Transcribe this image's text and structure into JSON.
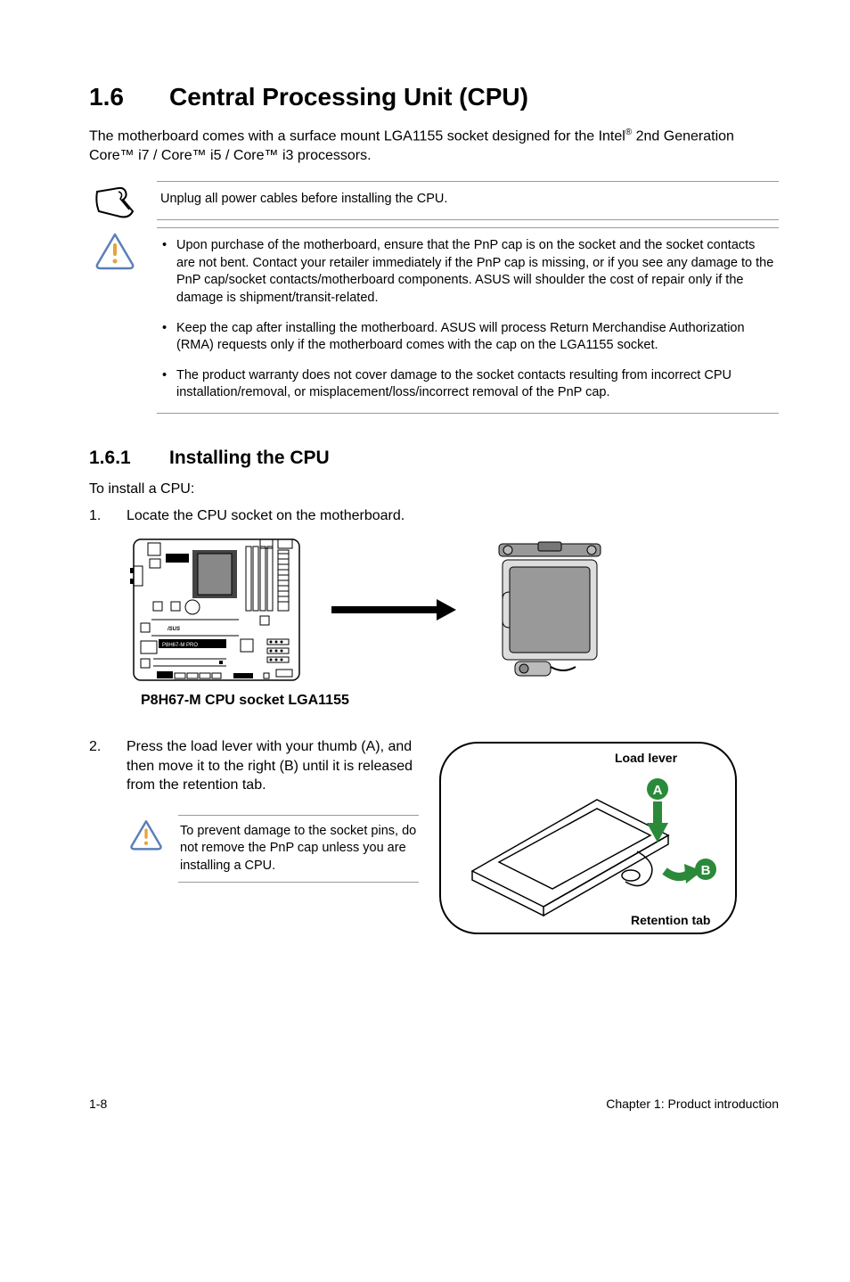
{
  "heading": {
    "num": "1.6",
    "title": "Central Processing Unit (CPU)"
  },
  "intro": {
    "line1a": "The motherboard comes with a surface mount LGA1155 socket designed for the Intel",
    "sup": "®",
    "line1b": " 2nd Generation Core™ i7 / Core™ i5 / Core™ i3 processors."
  },
  "note1": "Unplug all power cables before installing the CPU.",
  "warn_bullets": [
    "Upon purchase of the motherboard, ensure that the PnP cap is on the socket and the socket contacts are not bent. Contact your retailer immediately if the PnP cap is missing, or if you see any damage to the PnP cap/socket contacts/motherboard components. ASUS will shoulder the cost of repair only if the damage is shipment/transit-related.",
    "Keep the cap after installing the motherboard. ASUS will process Return Merchandise Authorization (RMA) requests only if the motherboard comes with the cap on the LGA1155 socket.",
    "The product warranty does not cover damage to the socket contacts resulting from incorrect CPU installation/removal, or misplacement/loss/incorrect removal of the PnP cap."
  ],
  "sub": {
    "num": "1.6.1",
    "title": "Installing the CPU"
  },
  "sub_intro": "To install a CPU:",
  "step1": {
    "num": "1.",
    "text": "Locate the CPU socket on the motherboard."
  },
  "board_label": "P8H67-M PRO",
  "caption": "P8H67-M CPU socket LGA1155",
  "step2": {
    "num": "2.",
    "text": "Press the load lever with your thumb (A), and then move it to the right (B) until it is released from the retention tab."
  },
  "inner_warn": "To prevent damage to the socket pins, do not remove the PnP cap unless you are installing a CPU.",
  "fig_labels": {
    "load_lever": "Load lever",
    "retention_tab": "Retention tab",
    "a": "A",
    "b": "B"
  },
  "footer": {
    "left": "1-8",
    "right": "Chapter 1: Product introduction"
  }
}
